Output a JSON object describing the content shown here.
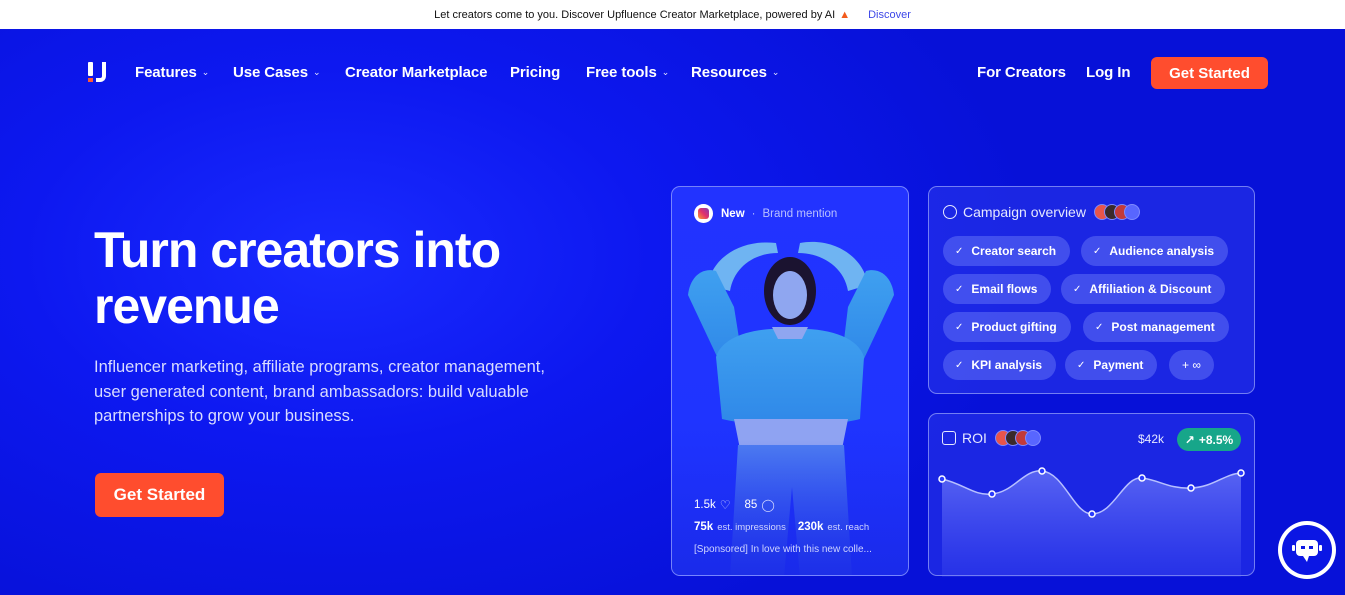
{
  "announcement": {
    "text": "Let creators come to you. Discover Upfluence Creator Marketplace, powered by AI",
    "link": "Discover"
  },
  "nav": {
    "items": [
      {
        "label": "Features",
        "dropdown": true
      },
      {
        "label": "Use Cases",
        "dropdown": true
      },
      {
        "label": "Creator Marketplace",
        "dropdown": false
      },
      {
        "label": "Pricing",
        "dropdown": false
      },
      {
        "label": "Free tools",
        "dropdown": true
      },
      {
        "label": "Resources",
        "dropdown": true
      }
    ],
    "for_creators": "For Creators",
    "login": "Log In",
    "cta": "Get Started"
  },
  "hero": {
    "headline": "Turn creators into revenue",
    "subtext": "Influencer marketing, affiliate programs, creator management, user generated content, brand ambassadors: build valuable partnerships to grow your business.",
    "cta": "Get Started"
  },
  "post_card": {
    "badge": "New",
    "type": "Brand mention",
    "likes": "1.5k",
    "comments": "85",
    "impressions": "75k",
    "impressions_label": "est. impressions",
    "reach": "230k",
    "reach_label": "est. reach",
    "caption": "[Sponsored] In love with this new colle..."
  },
  "campaign": {
    "title": "Campaign overview",
    "chips": [
      "Creator search",
      "Audience analysis",
      "Email flows",
      "Affiliation & Discount",
      "Product gifting",
      "Post management",
      "KPI analysis",
      "Payment",
      "+ ∞"
    ]
  },
  "roi": {
    "title": "ROI",
    "value": "$42k",
    "change": "+8.5%"
  },
  "colors": {
    "brand_blue": "#0a14e8",
    "cta_orange": "#ff4d2e",
    "roi_badge": "#17a68a"
  },
  "icons": [
    "upfluence-logo-icon",
    "flame-icon",
    "chevron-down-icon",
    "instagram-icon",
    "heart-icon",
    "comment-icon",
    "check-icon",
    "campaign-icon",
    "roi-icon",
    "trend-up-icon",
    "chatbot-icon"
  ]
}
